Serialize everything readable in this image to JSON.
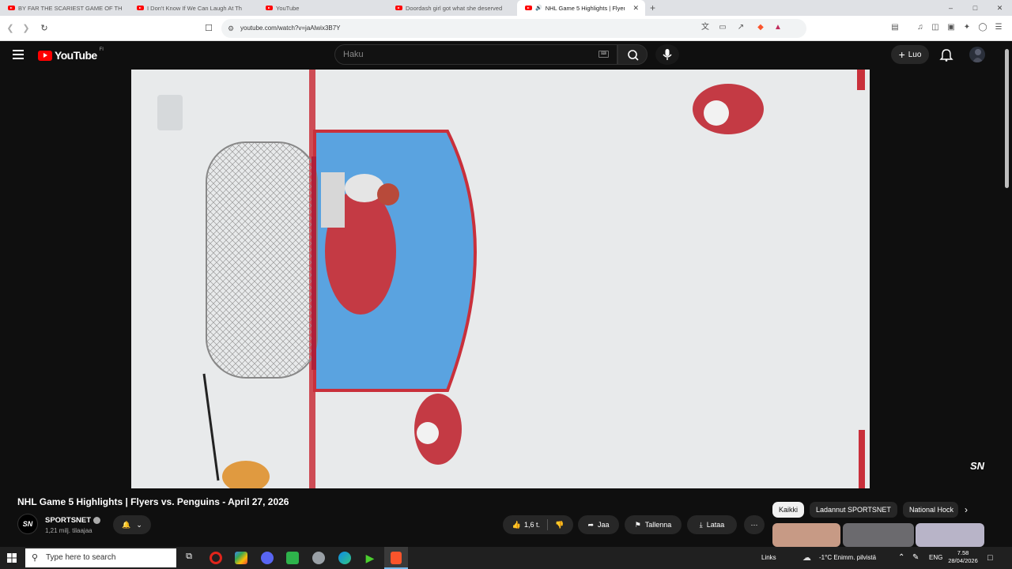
{
  "browser": {
    "tabs": [
      {
        "label": "BY FAR THE SCARIEST GAME OF THE",
        "active": false
      },
      {
        "label": "I Don't Know If We Can Laugh At Th",
        "active": false
      },
      {
        "label": "YouTube",
        "active": false
      },
      {
        "label": "Doordash girl got what she deserved",
        "active": false
      },
      {
        "label": "NHL Game 5 Highlights | Flyers",
        "active": true
      }
    ],
    "url": "youtube.com/watch?v=jaAlwix3B7Y"
  },
  "youtube": {
    "logo_text": "YouTube",
    "country": "FI",
    "search_placeholder": "Haku",
    "create_label": "Luo"
  },
  "video": {
    "watermark": "SN",
    "title": "NHL Game 5 Highlights | Flyers vs. Penguins - April 27, 2026",
    "channel": "SPORTSNET",
    "channel_avatar": "SN",
    "subscribers": "1,21 milj. tilaajaa",
    "likes": "1,6 t.",
    "share_label": "Jaa",
    "save_label": "Tallenna",
    "download_label": "Lataa"
  },
  "chips": [
    "Kaikki",
    "Ladannut SPORTSNET",
    "National Hock"
  ],
  "taskbar": {
    "search_placeholder": "Type here to search",
    "links_label": "Links",
    "weather": "-1°C  Enimm. pilvistä",
    "lang": "ENG",
    "time": "7.58",
    "date": "28/04/2026"
  }
}
